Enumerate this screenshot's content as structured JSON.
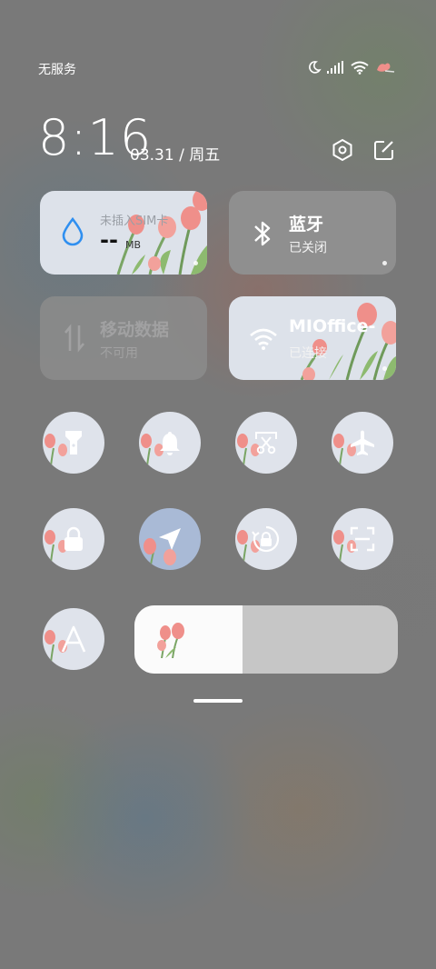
{
  "status_bar": {
    "carrier": "无服务",
    "icons": [
      "moon-icon",
      "signal-icon",
      "wifi-icon",
      "battery-icon"
    ]
  },
  "header": {
    "time": "8:16",
    "date": "03.31 / 周五",
    "icons": [
      "settings-icon",
      "edit-icon"
    ]
  },
  "tiles": {
    "data_usage": {
      "title": "未插入SIM卡",
      "value": "--",
      "unit": "MB",
      "icon": "drop-icon"
    },
    "bluetooth": {
      "title": "蓝牙",
      "subtitle": "已关闭",
      "icon": "bluetooth-icon"
    },
    "mobile_data": {
      "title": "移动数据",
      "subtitle": "不可用",
      "icon": "data-arrows-icon"
    },
    "wifi": {
      "title": "MIOffice-",
      "subtitle": "已连接",
      "icon": "wifi-icon"
    }
  },
  "toggles": [
    {
      "name": "flashlight",
      "icon": "flashlight-icon",
      "active": false
    },
    {
      "name": "ringer",
      "icon": "bell-icon",
      "active": false
    },
    {
      "name": "screenshot",
      "icon": "scissors-icon",
      "active": false
    },
    {
      "name": "airplane",
      "icon": "airplane-icon",
      "active": false
    },
    {
      "name": "lock-screen",
      "icon": "lock-icon",
      "active": false
    },
    {
      "name": "location",
      "icon": "location-arrow-icon",
      "active": true
    },
    {
      "name": "auto-rotate",
      "icon": "rotate-lock-icon",
      "active": false
    },
    {
      "name": "scan",
      "icon": "scan-icon",
      "active": false
    },
    {
      "name": "auto-brightness",
      "icon": "letter-a-icon",
      "active": false
    }
  ],
  "brightness": {
    "level": 0.41
  },
  "colors": {
    "tile_bg": "#dde2ea",
    "active_bg": "#a9bad6",
    "accent_blue": "#2f8ff0",
    "tulip": "#ef8f8a"
  }
}
